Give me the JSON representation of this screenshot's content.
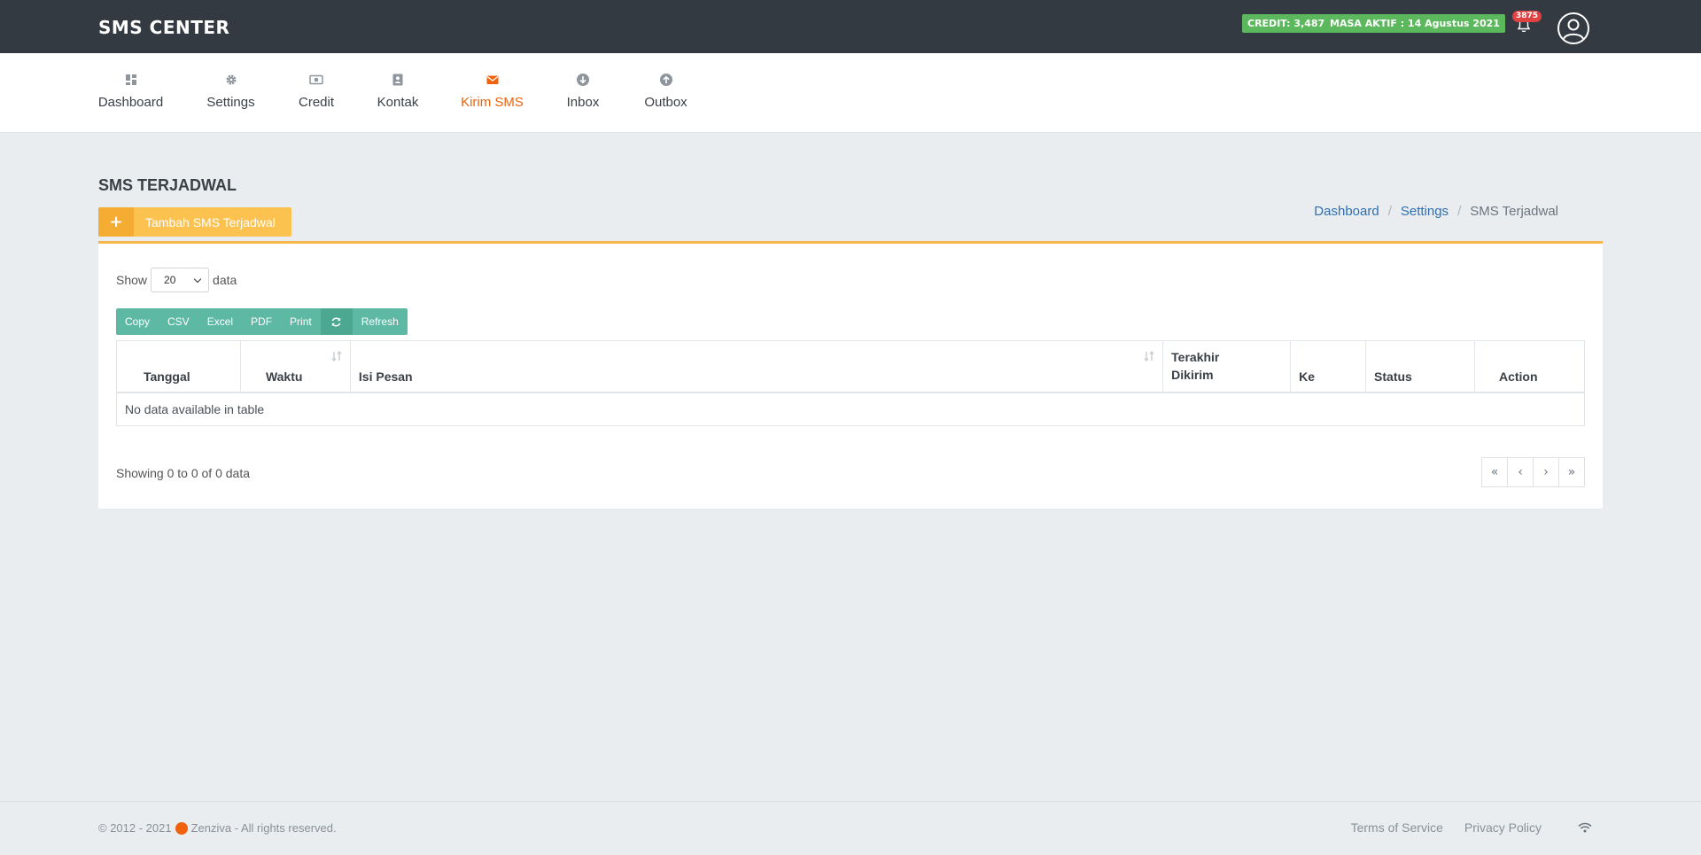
{
  "header": {
    "brand": "SMS CENTER",
    "credit_badge": "CREDIT: 3,487",
    "masa_badge": "MASA AKTIF : 14 Agustus 2021",
    "notification_count": "3875",
    "colors": {
      "topbar": "#343a42",
      "badge": "#5cb85c",
      "accent": "#f0620d"
    }
  },
  "nav": {
    "items": [
      {
        "label": "Dashboard",
        "icon": "dashboard-icon"
      },
      {
        "label": "Settings",
        "icon": "gear-icon"
      },
      {
        "label": "Credit",
        "icon": "money-icon"
      },
      {
        "label": "Kontak",
        "icon": "contact-card-icon"
      },
      {
        "label": "Kirim SMS",
        "icon": "envelope-icon",
        "active": true
      },
      {
        "label": "Inbox",
        "icon": "arrow-down-circle-icon"
      },
      {
        "label": "Outbox",
        "icon": "arrow-up-circle-icon"
      }
    ]
  },
  "page": {
    "title": "SMS TERJADWAL",
    "add_button": "Tambah SMS Terjadwal",
    "breadcrumb": [
      "Dashboard",
      "Settings",
      "SMS Terjadwal"
    ]
  },
  "table": {
    "show_label": "Show",
    "page_size": "20",
    "data_label": "data",
    "buttons": [
      "Copy",
      "CSV",
      "Excel",
      "PDF",
      "Print",
      "Refresh"
    ],
    "columns": [
      "Tanggal",
      "Waktu",
      "Isi Pesan",
      "Terakhir Dikirim",
      "Ke",
      "Status",
      "Action"
    ],
    "empty_text": "No data available in table",
    "info": "Showing 0 to 0 of 0 data",
    "pager": [
      "«",
      "‹",
      "›",
      "»"
    ]
  },
  "footer": {
    "copyright_prefix": "© 2012 - 2021",
    "copyright_suffix": "Zenziva - All rights reserved.",
    "links": [
      "Terms of Service",
      "Privacy Policy"
    ]
  }
}
